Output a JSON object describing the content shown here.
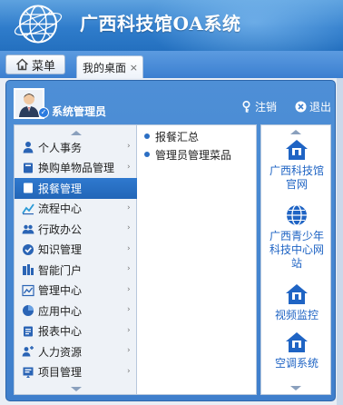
{
  "header": {
    "title": "广西科技馆OA系统"
  },
  "tabbar": {
    "menu_label": "菜单",
    "tabs": [
      {
        "label": "我的桌面",
        "close": "×"
      }
    ]
  },
  "panel": {
    "username": "系统管理员",
    "logout_label": "注销",
    "exit_label": "退出",
    "menu_items": [
      {
        "label": "个人事务",
        "icon": "person-icon"
      },
      {
        "label": "换购单物品管理",
        "icon": "book-icon"
      },
      {
        "label": "报餐管理",
        "icon": "book-icon",
        "active": true
      },
      {
        "label": "流程中心",
        "icon": "flow-icon"
      },
      {
        "label": "行政办公",
        "icon": "people-icon"
      },
      {
        "label": "知识管理",
        "icon": "knowledge-icon"
      },
      {
        "label": "智能门户",
        "icon": "portal-icon"
      },
      {
        "label": "管理中心",
        "icon": "chart-icon"
      },
      {
        "label": "应用中心",
        "icon": "pie-icon"
      },
      {
        "label": "报表中心",
        "icon": "report-icon"
      },
      {
        "label": "人力资源",
        "icon": "hr-icon"
      },
      {
        "label": "项目管理",
        "icon": "project-icon"
      }
    ],
    "sub_items": [
      "报餐汇总",
      "管理员管理菜品"
    ],
    "shortcuts": [
      {
        "label_lines": [
          "广西科技馆",
          "官网"
        ],
        "icon": "home-icon"
      },
      {
        "label_lines": [
          "广西青少年",
          "科技中心网",
          "站"
        ],
        "icon": "globe-icon"
      },
      {
        "label_lines": [
          "视频监控"
        ],
        "icon": "home-icon"
      },
      {
        "label_lines": [
          "空调系统"
        ],
        "icon": "home-icon"
      }
    ]
  },
  "colors": {
    "header": "#2f7ccb",
    "accent": "#2266b8",
    "link": "#1f64c4"
  }
}
